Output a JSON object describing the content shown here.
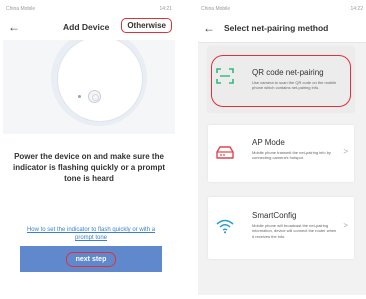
{
  "left_screen": {
    "status": {
      "carrier": "China Mobile",
      "time": "14:21"
    },
    "header": {
      "title": "Add Device",
      "otherwise_label": "Otherwise"
    },
    "instruction": "Power the device on and make sure the indicator is flashing quickly or a prompt tone is heard",
    "help_link": "How to set the indicator to flash quickly or with a prompt tone",
    "next_label": "next step"
  },
  "right_screen": {
    "status": {
      "carrier": "China Mobile",
      "time": "14:22"
    },
    "header": {
      "title": "Select net-pairing method"
    },
    "methods": [
      {
        "title": "QR code net-pairing",
        "desc": "Use camera to scan the QR code on the mobile phone which contains net-pairing info.",
        "icon": "qr-scan-icon"
      },
      {
        "title": "AP Mode",
        "desc": "Mobile phone transmit the net-pairing info by connecting camera's hotspot.",
        "icon": "router-icon"
      },
      {
        "title": "SmartConfig",
        "desc": "Mobile phone will broadcast the net-pairing information, device will connect the router when it receives the info.",
        "icon": "wifi-icon"
      }
    ]
  },
  "colors": {
    "accent_blue": "#5f89cc",
    "highlight_red": "#e0303a",
    "qr_green": "#2dbb7b",
    "ap_red": "#e0454d",
    "wifi_blue": "#2a9bd8",
    "link_blue": "#3a7fd1"
  }
}
